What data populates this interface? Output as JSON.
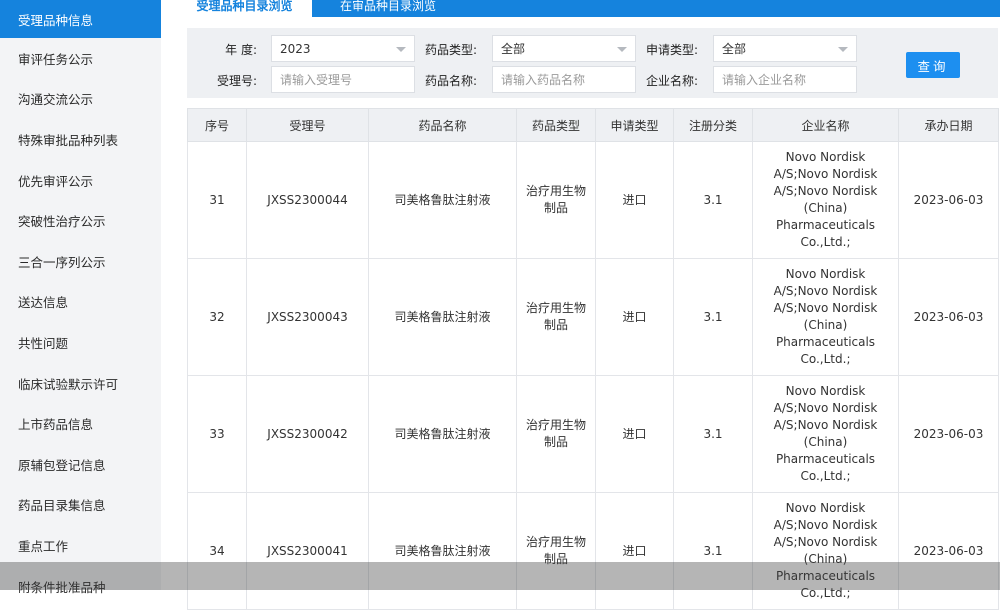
{
  "sidebar": {
    "items": [
      {
        "label": "受理品种信息"
      },
      {
        "label": "审评任务公示"
      },
      {
        "label": "沟通交流公示"
      },
      {
        "label": "特殊审批品种列表"
      },
      {
        "label": "优先审评公示"
      },
      {
        "label": "突破性治疗公示"
      },
      {
        "label": "三合一序列公示"
      },
      {
        "label": "送达信息"
      },
      {
        "label": "共性问题"
      },
      {
        "label": "临床试验默示许可"
      },
      {
        "label": "上市药品信息"
      },
      {
        "label": "原辅包登记信息"
      },
      {
        "label": "药品目录集信息"
      },
      {
        "label": "重点工作"
      },
      {
        "label": "附条件批准品种"
      }
    ]
  },
  "tabs": [
    {
      "label": "受理品种目录浏览"
    },
    {
      "label": "在审品种目录浏览"
    }
  ],
  "filters": {
    "year_label": "年   度:",
    "year_value": "2023",
    "drug_type_label": "药品类型:",
    "drug_type_value": "全部",
    "apply_type_label": "申请类型:",
    "apply_type_value": "全部",
    "accept_no_label": "受理号:",
    "accept_no_placeholder": "请输入受理号",
    "drug_name_label": "药品名称:",
    "drug_name_placeholder": "请输入药品名称",
    "company_label": "企业名称:",
    "company_placeholder": "请输入企业名称",
    "query_button": "查询"
  },
  "table": {
    "headers": [
      "序号",
      "受理号",
      "药品名称",
      "药品类型",
      "申请类型",
      "注册分类",
      "企业名称",
      "承办日期"
    ],
    "rows": [
      {
        "no": "31",
        "accept_no": "JXSS2300044",
        "drug_name": "司美格鲁肽注射液",
        "drug_type": "治疗用生物制品",
        "apply_type": "进口",
        "reg_class": "3.1",
        "company": "Novo Nordisk A/S;Novo Nordisk A/S;Novo Nordisk (China) Pharmaceuticals Co.,Ltd.;",
        "date": "2023-06-03"
      },
      {
        "no": "32",
        "accept_no": "JXSS2300043",
        "drug_name": "司美格鲁肽注射液",
        "drug_type": "治疗用生物制品",
        "apply_type": "进口",
        "reg_class": "3.1",
        "company": "Novo Nordisk A/S;Novo Nordisk A/S;Novo Nordisk (China) Pharmaceuticals Co.,Ltd.;",
        "date": "2023-06-03"
      },
      {
        "no": "33",
        "accept_no": "JXSS2300042",
        "drug_name": "司美格鲁肽注射液",
        "drug_type": "治疗用生物制品",
        "apply_type": "进口",
        "reg_class": "3.1",
        "company": "Novo Nordisk A/S;Novo Nordisk A/S;Novo Nordisk (China) Pharmaceuticals Co.,Ltd.;",
        "date": "2023-06-03"
      },
      {
        "no": "34",
        "accept_no": "JXSS2300041",
        "drug_name": "司美格鲁肽注射液",
        "drug_type": "治疗用生物制品",
        "apply_type": "进口",
        "reg_class": "3.1",
        "company": "Novo Nordisk A/S;Novo Nordisk A/S;Novo Nordisk (China) Pharmaceuticals Co.,Ltd.;",
        "date": "2023-06-03"
      }
    ]
  }
}
